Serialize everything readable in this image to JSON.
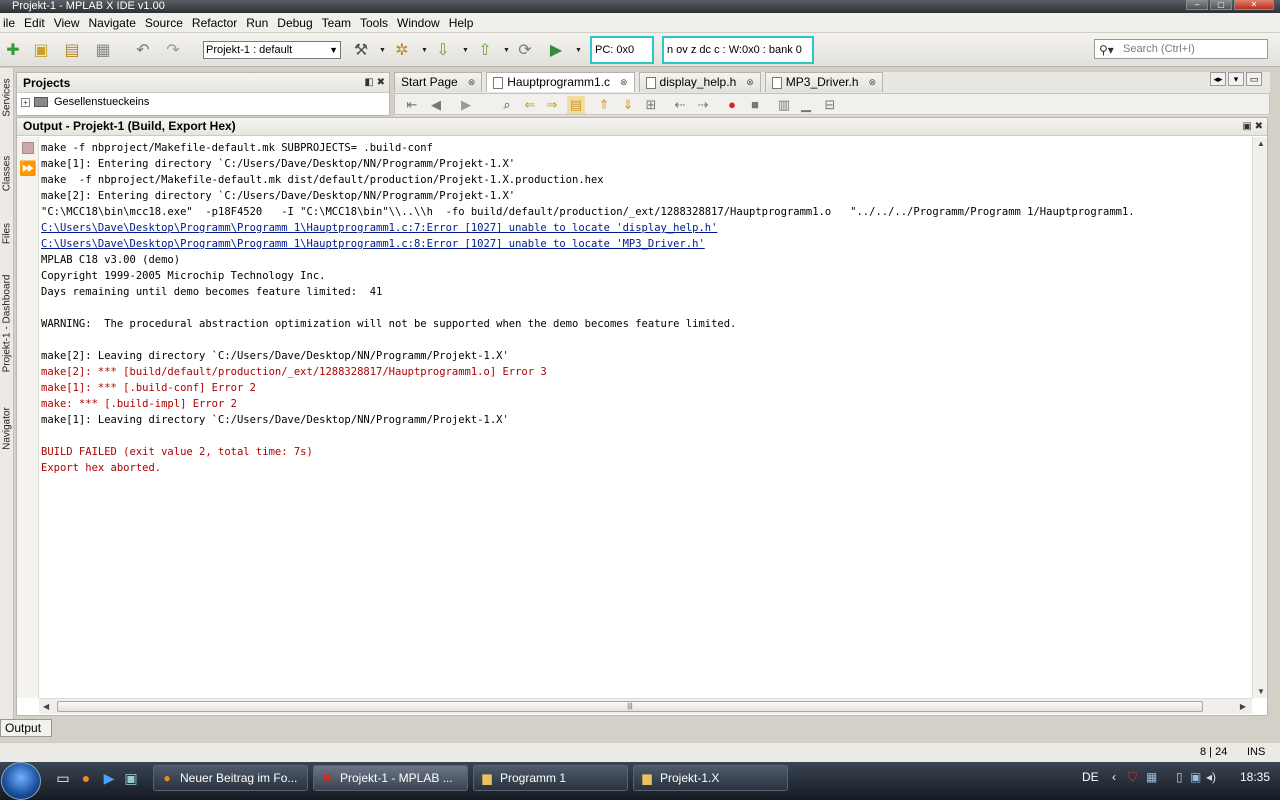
{
  "window": {
    "title": "Projekt-1 - MPLAB X IDE v1.00",
    "min": "–",
    "max": "▢",
    "close": "✕"
  },
  "menu": [
    "ile",
    "Edit",
    "View",
    "Navigate",
    "Source",
    "Refactor",
    "Run",
    "Debug",
    "Team",
    "Tools",
    "Window",
    "Help"
  ],
  "toolbar": {
    "config": "Projekt-1 : default",
    "pc": "PC: 0x0",
    "status": "n ov z dc c  : W:0x0 : bank 0",
    "search_placeholder": "Search (Ctrl+I)"
  },
  "side_tabs": [
    "Services",
    "Classes",
    "Files",
    "Projekt-1 - Dashboard",
    "Navigator"
  ],
  "projects": {
    "title": "Projects",
    "tree_item": "Gesellenstueckeins",
    "controls": "◧ ✖"
  },
  "editor": {
    "tabs": [
      {
        "label": "Start Page",
        "active": false
      },
      {
        "label": "Hauptprogramm1.c",
        "active": true
      },
      {
        "label": "display_help.h",
        "active": false
      },
      {
        "label": "MP3_Driver.h",
        "active": false
      }
    ],
    "close_glyph": "⊗"
  },
  "output": {
    "title": "Output - Projekt-1 (Build, Export Hex)",
    "controls": "▣ ✖",
    "lines": [
      {
        "text": "make -f nbproject/Makefile-default.mk SUBPROJECTS= .build-conf",
        "type": "normal"
      },
      {
        "text": "make[1]: Entering directory `C:/Users/Dave/Desktop/NN/Programm/Projekt-1.X'",
        "type": "normal"
      },
      {
        "text": "make  -f nbproject/Makefile-default.mk dist/default/production/Projekt-1.X.production.hex",
        "type": "normal"
      },
      {
        "text": "make[2]: Entering directory `C:/Users/Dave/Desktop/NN/Programm/Projekt-1.X'",
        "type": "normal"
      },
      {
        "text": "\"C:\\MCC18\\bin\\mcc18.exe\"  -p18F4520   -I \"C:\\MCC18\\bin\"\\\\..\\\\h  -fo build/default/production/_ext/1288328817/Hauptprogramm1.o   \"../../../Programm/Programm 1/Hauptprogramm1.",
        "type": "normal"
      },
      {
        "text": "C:\\Users\\Dave\\Desktop\\Programm\\Programm 1\\Hauptprogramm1.c:7:Error [1027] unable to locate 'display_help.h'",
        "type": "link"
      },
      {
        "text": "C:\\Users\\Dave\\Desktop\\Programm\\Programm 1\\Hauptprogramm1.c:8:Error [1027] unable to locate 'MP3_Driver.h'",
        "type": "link"
      },
      {
        "text": "MPLAB C18 v3.00 (demo)",
        "type": "normal"
      },
      {
        "text": "Copyright 1999-2005 Microchip Technology Inc.",
        "type": "normal"
      },
      {
        "text": "Days remaining until demo becomes feature limited:  41",
        "type": "normal"
      },
      {
        "text": "",
        "type": "normal"
      },
      {
        "text": "WARNING:  The procedural abstraction optimization will not be supported when the demo becomes feature limited.",
        "type": "normal"
      },
      {
        "text": "",
        "type": "normal"
      },
      {
        "text": "make[2]: Leaving directory `C:/Users/Dave/Desktop/NN/Programm/Projekt-1.X'",
        "type": "normal"
      },
      {
        "text": "make[2]: *** [build/default/production/_ext/1288328817/Hauptprogramm1.o] Error 3",
        "type": "err"
      },
      {
        "text": "make[1]: *** [.build-conf] Error 2",
        "type": "err"
      },
      {
        "text": "make: *** [.build-impl] Error 2",
        "type": "err"
      },
      {
        "text": "make[1]: Leaving directory `C:/Users/Dave/Desktop/NN/Programm/Projekt-1.X'",
        "type": "normal"
      },
      {
        "text": "",
        "type": "normal"
      },
      {
        "text": "BUILD FAILED (exit value 2, total time: 7s)",
        "type": "err"
      },
      {
        "text": "Export hex aborted.",
        "type": "err"
      }
    ]
  },
  "output_tab": "Output",
  "statusbar": {
    "position": "8 | 24",
    "mode": "INS"
  },
  "taskbar": {
    "buttons": [
      {
        "label": "Neuer Beitrag im Fo...",
        "icon": "firefox-icon",
        "active": false
      },
      {
        "label": "Projekt-1 - MPLAB ...",
        "icon": "mplab-icon",
        "active": true
      },
      {
        "label": "Programm 1",
        "icon": "folder-icon",
        "active": false
      },
      {
        "label": "Projekt-1.X",
        "icon": "folder-icon",
        "active": false
      }
    ],
    "lang": "DE",
    "clock": "18:35"
  }
}
